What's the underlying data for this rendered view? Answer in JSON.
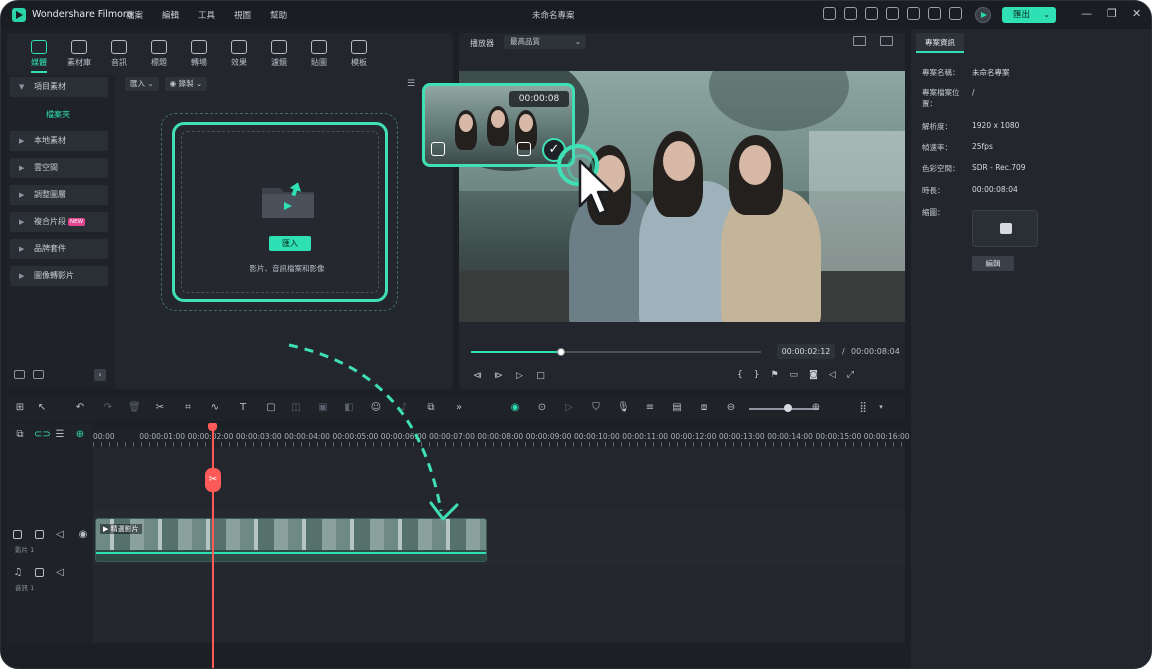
{
  "app": {
    "name": "Wondershare Filmora",
    "project_title": "未命名專案",
    "menu": [
      "檔案",
      "編輯",
      "工具",
      "視圖",
      "幫助"
    ],
    "export_label": "匯出",
    "colors": {
      "accent": "#2ee0b3",
      "playhead": "#ff5a5a",
      "background": "#1c1f24"
    }
  },
  "tool_tabs": [
    {
      "label": "媒體",
      "icon": "media-icon"
    },
    {
      "label": "素材庫",
      "icon": "stock-icon"
    },
    {
      "label": "音訊",
      "icon": "music-icon"
    },
    {
      "label": "標題",
      "icon": "title-icon"
    },
    {
      "label": "轉場",
      "icon": "transition-icon"
    },
    {
      "label": "效果",
      "icon": "effects-icon"
    },
    {
      "label": "濾鏡",
      "icon": "filter-icon"
    },
    {
      "label": "貼圖",
      "icon": "sticker-icon"
    },
    {
      "label": "模板",
      "icon": "template-icon"
    }
  ],
  "sidebar": {
    "items": [
      {
        "label": "項目素材"
      },
      {
        "label": "檔案夾"
      },
      {
        "label": "本地素材"
      },
      {
        "label": "雲空間"
      },
      {
        "label": "調整圖層"
      },
      {
        "label": "複合片段",
        "badge": "NEW"
      },
      {
        "label": "品牌套件"
      },
      {
        "label": "圖像轉影片"
      }
    ]
  },
  "media_toolbar": {
    "import_label": "匯入",
    "record_label": "錄製"
  },
  "drop_zone": {
    "button_label": "匯入",
    "hint": "影片、音訊檔案和影像"
  },
  "preview": {
    "player_label": "播放器",
    "quality": "最高品質",
    "current_time": "00:00:02:12",
    "separator": "/",
    "total_time": "00:00:08:04",
    "progress": 0.31,
    "clip_popup_time": "00:00:08"
  },
  "info_panel": {
    "tab_label": "專案資訊",
    "rows": [
      {
        "label": "專案名稱：",
        "value": "未命名專案"
      },
      {
        "label": "專案檔案位置：",
        "value": "/"
      },
      {
        "label": "解析度：",
        "value": "1920 x 1080"
      },
      {
        "label": "幀速率：",
        "value": "25fps"
      },
      {
        "label": "色彩空間：",
        "value": "SDR - Rec.709"
      },
      {
        "label": "時長：",
        "value": "00:00:08:04"
      },
      {
        "label": "縮圖：",
        "value": ""
      }
    ],
    "edit_label": "編輯"
  },
  "timeline": {
    "ruler": [
      "00:00",
      "00:00:01:00",
      "00:00:02:00",
      "00:00:03:00",
      "00:00:04:00",
      "00:00:05:00",
      "00:00:06:00",
      "00:00:07:00",
      "00:00:08:00",
      "00:00:09:00",
      "00:00:10:00",
      "00:00:11:00",
      "00:00:12:00",
      "00:00:13:00",
      "00:00:14:00",
      "00:00:15:00",
      "00:00:16:00"
    ],
    "video_track_label": "影片 1",
    "audio_track_label": "音訊 1",
    "clip_name": "精選影片"
  }
}
